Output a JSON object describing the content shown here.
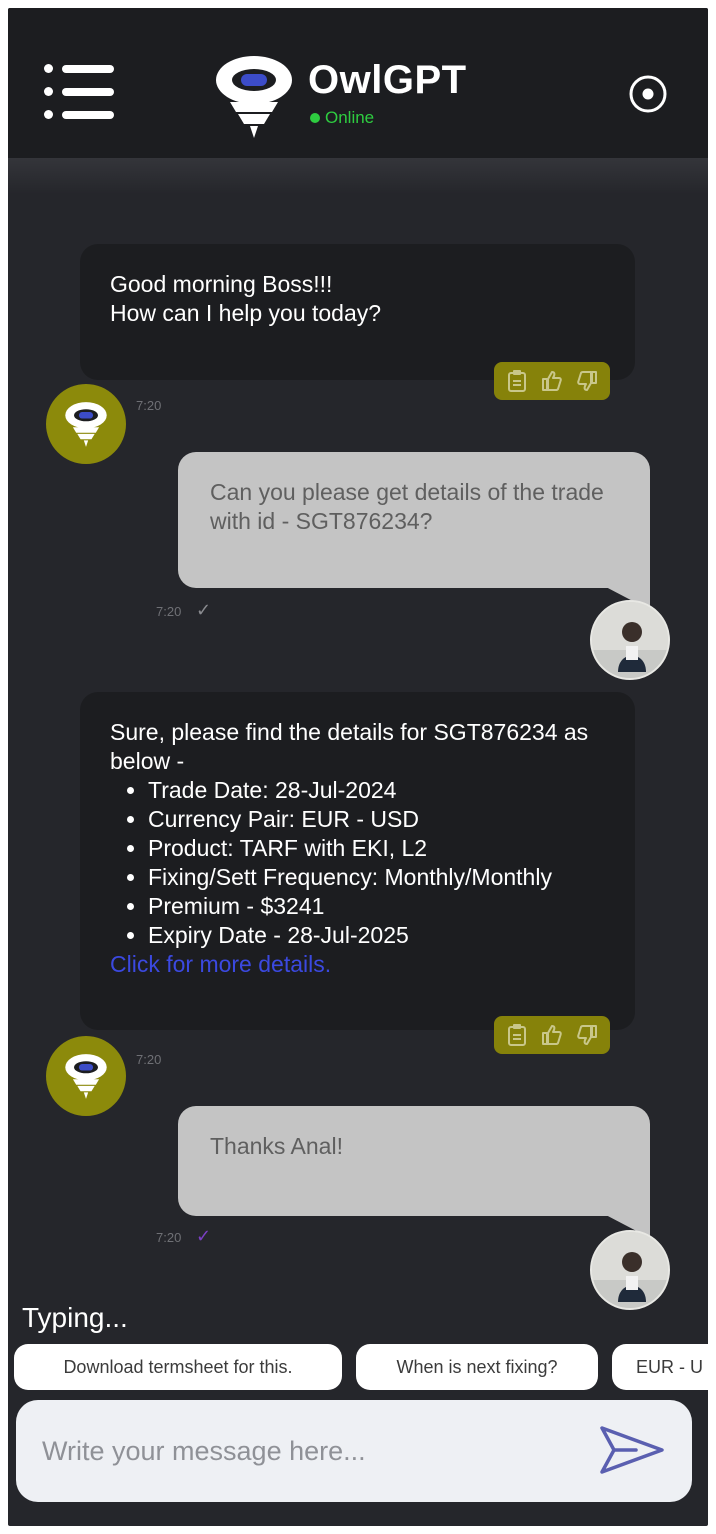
{
  "header": {
    "title": "OwlGPT",
    "status": "Online",
    "menu_icon": "menu-icon",
    "settings_icon": "settings-icon"
  },
  "messages": [
    {
      "sender": "bot",
      "lines": [
        "Good morning Boss!!!",
        "How can I help you today?"
      ],
      "time": "7:20"
    },
    {
      "sender": "user",
      "text": "Can you please get details of the trade with id - SGT876234?",
      "time": "7:20",
      "read_receipt": "✓"
    },
    {
      "sender": "bot",
      "intro": "Sure, please find the details for SGT876234 as below -",
      "items": [
        "Trade Date: 28-Jul-2024",
        "Currency Pair: EUR - USD",
        "Product: TARF with EKI, L2",
        "Fixing/Sett Frequency: Monthly/Monthly",
        "Premium - $3241",
        "Expiry Date - 28-Jul-2025"
      ],
      "link": "Click for more details.",
      "time": "7:20"
    },
    {
      "sender": "user",
      "text": "Thanks Anal!",
      "time": "7:20",
      "read_receipt": "✓"
    }
  ],
  "typing_indicator": "Typing...",
  "suggestions": [
    "Download termsheet for this.",
    "When is next fixing?",
    "EUR - U"
  ],
  "composer": {
    "placeholder": "Write your message here...",
    "send_icon": "send-icon"
  },
  "colors": {
    "header_bg": "#1c1d20",
    "chat_bg": "#25262b",
    "bot_bubble": "#1c1d20",
    "user_bubble": "#c4c4c4",
    "accent_olive": "#86820a",
    "online_green": "#2ecc40",
    "link_blue": "#3b49e0",
    "read_purple": "#7b3fc4"
  }
}
